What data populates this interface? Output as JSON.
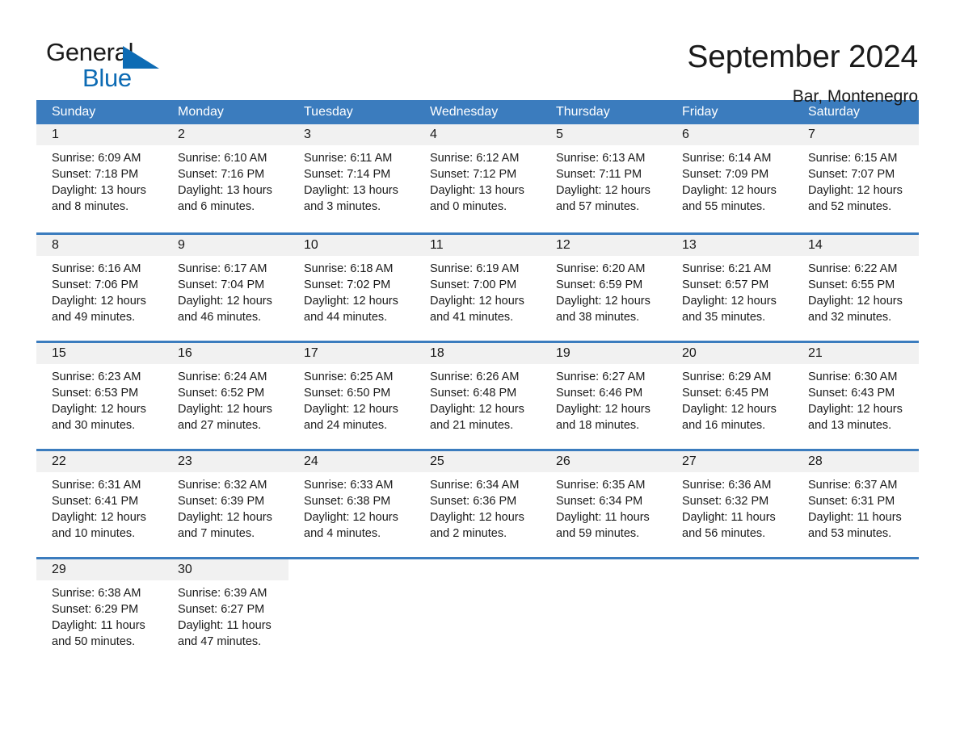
{
  "brand": {
    "name_part1": "General",
    "name_part2": "Blue",
    "accent_color": "#0d6bb4"
  },
  "header": {
    "title": "September 2024",
    "subtitle": "Bar, Montenegro"
  },
  "theme": {
    "header_row_bg": "#3b7cbe",
    "day_band_bg": "#f1f1f1",
    "text_color": "#1a1a1a"
  },
  "calendar": {
    "weekday_headers": [
      "Sunday",
      "Monday",
      "Tuesday",
      "Wednesday",
      "Thursday",
      "Friday",
      "Saturday"
    ],
    "weeks": [
      [
        {
          "day": "1",
          "sunrise": "Sunrise: 6:09 AM",
          "sunset": "Sunset: 7:18 PM",
          "daylight": "Daylight: 13 hours and 8 minutes."
        },
        {
          "day": "2",
          "sunrise": "Sunrise: 6:10 AM",
          "sunset": "Sunset: 7:16 PM",
          "daylight": "Daylight: 13 hours and 6 minutes."
        },
        {
          "day": "3",
          "sunrise": "Sunrise: 6:11 AM",
          "sunset": "Sunset: 7:14 PM",
          "daylight": "Daylight: 13 hours and 3 minutes."
        },
        {
          "day": "4",
          "sunrise": "Sunrise: 6:12 AM",
          "sunset": "Sunset: 7:12 PM",
          "daylight": "Daylight: 13 hours and 0 minutes."
        },
        {
          "day": "5",
          "sunrise": "Sunrise: 6:13 AM",
          "sunset": "Sunset: 7:11 PM",
          "daylight": "Daylight: 12 hours and 57 minutes."
        },
        {
          "day": "6",
          "sunrise": "Sunrise: 6:14 AM",
          "sunset": "Sunset: 7:09 PM",
          "daylight": "Daylight: 12 hours and 55 minutes."
        },
        {
          "day": "7",
          "sunrise": "Sunrise: 6:15 AM",
          "sunset": "Sunset: 7:07 PM",
          "daylight": "Daylight: 12 hours and 52 minutes."
        }
      ],
      [
        {
          "day": "8",
          "sunrise": "Sunrise: 6:16 AM",
          "sunset": "Sunset: 7:06 PM",
          "daylight": "Daylight: 12 hours and 49 minutes."
        },
        {
          "day": "9",
          "sunrise": "Sunrise: 6:17 AM",
          "sunset": "Sunset: 7:04 PM",
          "daylight": "Daylight: 12 hours and 46 minutes."
        },
        {
          "day": "10",
          "sunrise": "Sunrise: 6:18 AM",
          "sunset": "Sunset: 7:02 PM",
          "daylight": "Daylight: 12 hours and 44 minutes."
        },
        {
          "day": "11",
          "sunrise": "Sunrise: 6:19 AM",
          "sunset": "Sunset: 7:00 PM",
          "daylight": "Daylight: 12 hours and 41 minutes."
        },
        {
          "day": "12",
          "sunrise": "Sunrise: 6:20 AM",
          "sunset": "Sunset: 6:59 PM",
          "daylight": "Daylight: 12 hours and 38 minutes."
        },
        {
          "day": "13",
          "sunrise": "Sunrise: 6:21 AM",
          "sunset": "Sunset: 6:57 PM",
          "daylight": "Daylight: 12 hours and 35 minutes."
        },
        {
          "day": "14",
          "sunrise": "Sunrise: 6:22 AM",
          "sunset": "Sunset: 6:55 PM",
          "daylight": "Daylight: 12 hours and 32 minutes."
        }
      ],
      [
        {
          "day": "15",
          "sunrise": "Sunrise: 6:23 AM",
          "sunset": "Sunset: 6:53 PM",
          "daylight": "Daylight: 12 hours and 30 minutes."
        },
        {
          "day": "16",
          "sunrise": "Sunrise: 6:24 AM",
          "sunset": "Sunset: 6:52 PM",
          "daylight": "Daylight: 12 hours and 27 minutes."
        },
        {
          "day": "17",
          "sunrise": "Sunrise: 6:25 AM",
          "sunset": "Sunset: 6:50 PM",
          "daylight": "Daylight: 12 hours and 24 minutes."
        },
        {
          "day": "18",
          "sunrise": "Sunrise: 6:26 AM",
          "sunset": "Sunset: 6:48 PM",
          "daylight": "Daylight: 12 hours and 21 minutes."
        },
        {
          "day": "19",
          "sunrise": "Sunrise: 6:27 AM",
          "sunset": "Sunset: 6:46 PM",
          "daylight": "Daylight: 12 hours and 18 minutes."
        },
        {
          "day": "20",
          "sunrise": "Sunrise: 6:29 AM",
          "sunset": "Sunset: 6:45 PM",
          "daylight": "Daylight: 12 hours and 16 minutes."
        },
        {
          "day": "21",
          "sunrise": "Sunrise: 6:30 AM",
          "sunset": "Sunset: 6:43 PM",
          "daylight": "Daylight: 12 hours and 13 minutes."
        }
      ],
      [
        {
          "day": "22",
          "sunrise": "Sunrise: 6:31 AM",
          "sunset": "Sunset: 6:41 PM",
          "daylight": "Daylight: 12 hours and 10 minutes."
        },
        {
          "day": "23",
          "sunrise": "Sunrise: 6:32 AM",
          "sunset": "Sunset: 6:39 PM",
          "daylight": "Daylight: 12 hours and 7 minutes."
        },
        {
          "day": "24",
          "sunrise": "Sunrise: 6:33 AM",
          "sunset": "Sunset: 6:38 PM",
          "daylight": "Daylight: 12 hours and 4 minutes."
        },
        {
          "day": "25",
          "sunrise": "Sunrise: 6:34 AM",
          "sunset": "Sunset: 6:36 PM",
          "daylight": "Daylight: 12 hours and 2 minutes."
        },
        {
          "day": "26",
          "sunrise": "Sunrise: 6:35 AM",
          "sunset": "Sunset: 6:34 PM",
          "daylight": "Daylight: 11 hours and 59 minutes."
        },
        {
          "day": "27",
          "sunrise": "Sunrise: 6:36 AM",
          "sunset": "Sunset: 6:32 PM",
          "daylight": "Daylight: 11 hours and 56 minutes."
        },
        {
          "day": "28",
          "sunrise": "Sunrise: 6:37 AM",
          "sunset": "Sunset: 6:31 PM",
          "daylight": "Daylight: 11 hours and 53 minutes."
        }
      ],
      [
        {
          "day": "29",
          "sunrise": "Sunrise: 6:38 AM",
          "sunset": "Sunset: 6:29 PM",
          "daylight": "Daylight: 11 hours and 50 minutes."
        },
        {
          "day": "30",
          "sunrise": "Sunrise: 6:39 AM",
          "sunset": "Sunset: 6:27 PM",
          "daylight": "Daylight: 11 hours and 47 minutes."
        },
        {
          "day": "",
          "sunrise": "",
          "sunset": "",
          "daylight": ""
        },
        {
          "day": "",
          "sunrise": "",
          "sunset": "",
          "daylight": ""
        },
        {
          "day": "",
          "sunrise": "",
          "sunset": "",
          "daylight": ""
        },
        {
          "day": "",
          "sunrise": "",
          "sunset": "",
          "daylight": ""
        },
        {
          "day": "",
          "sunrise": "",
          "sunset": "",
          "daylight": ""
        }
      ]
    ]
  }
}
